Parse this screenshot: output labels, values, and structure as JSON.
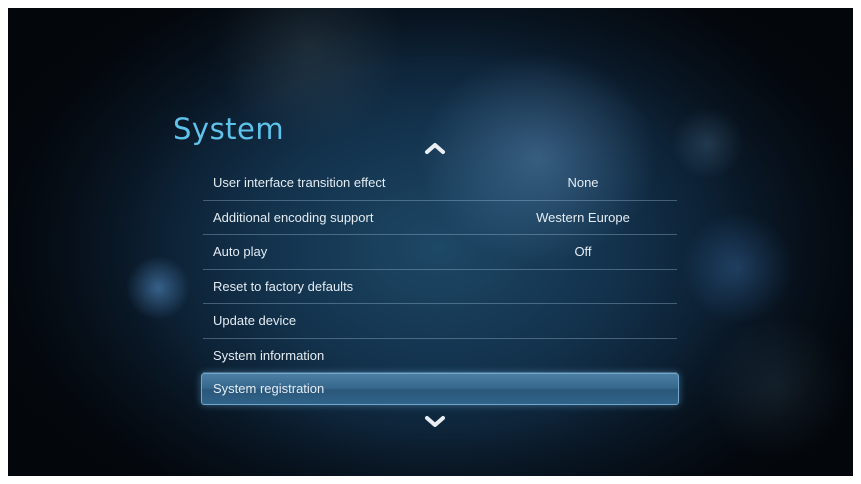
{
  "screen": {
    "title": "System"
  },
  "navigation": {
    "up_icon": "chevron-up-icon",
    "down_icon": "chevron-down-icon"
  },
  "menu": {
    "items": [
      {
        "label": "User interface transition effect",
        "value": "None"
      },
      {
        "label": "Additional encoding support",
        "value": "Western Europe"
      },
      {
        "label": "Auto play",
        "value": "Off"
      },
      {
        "label": "Reset to factory defaults",
        "value": ""
      },
      {
        "label": "Update device",
        "value": ""
      },
      {
        "label": "System information",
        "value": ""
      },
      {
        "label": "System registration",
        "value": "",
        "selected": true
      }
    ]
  },
  "colors": {
    "title": "#5ec3ea",
    "selection_highlight": "#35668c",
    "background": "#12304a"
  }
}
